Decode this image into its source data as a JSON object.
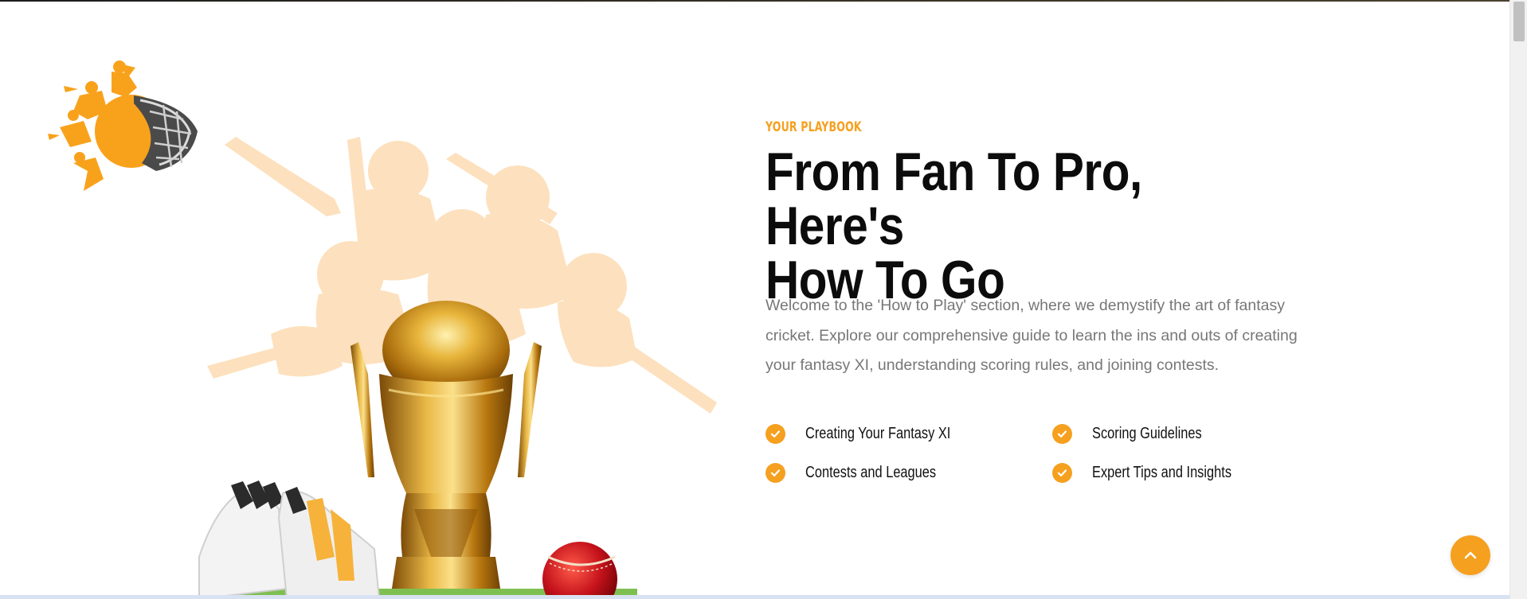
{
  "section": {
    "eyebrow": "YOUR PLAYBOOK",
    "title_line1": "From Fan To Pro, Here's",
    "title_line2": "How To Go",
    "intro": "Welcome to the 'How to Play' section, where we demystify the art of fantasy cricket. Explore our comprehensive guide to learn the ins and outs of creating your fantasy XI, understanding scoring rules, and joining contests."
  },
  "features": [
    {
      "label": "Creating Your Fantasy XI"
    },
    {
      "label": "Scoring Guidelines"
    },
    {
      "label": "Contests and Leagues"
    },
    {
      "label": "Expert Tips and Insights"
    }
  ],
  "icons": {
    "feature_icon": "check-circle-icon",
    "back_to_top": "chevron-up-icon"
  },
  "colors": {
    "accent": "#f5a01f",
    "heading": "#0c0c0c",
    "body_text": "#777777",
    "silhouette": "#fde0bd"
  }
}
